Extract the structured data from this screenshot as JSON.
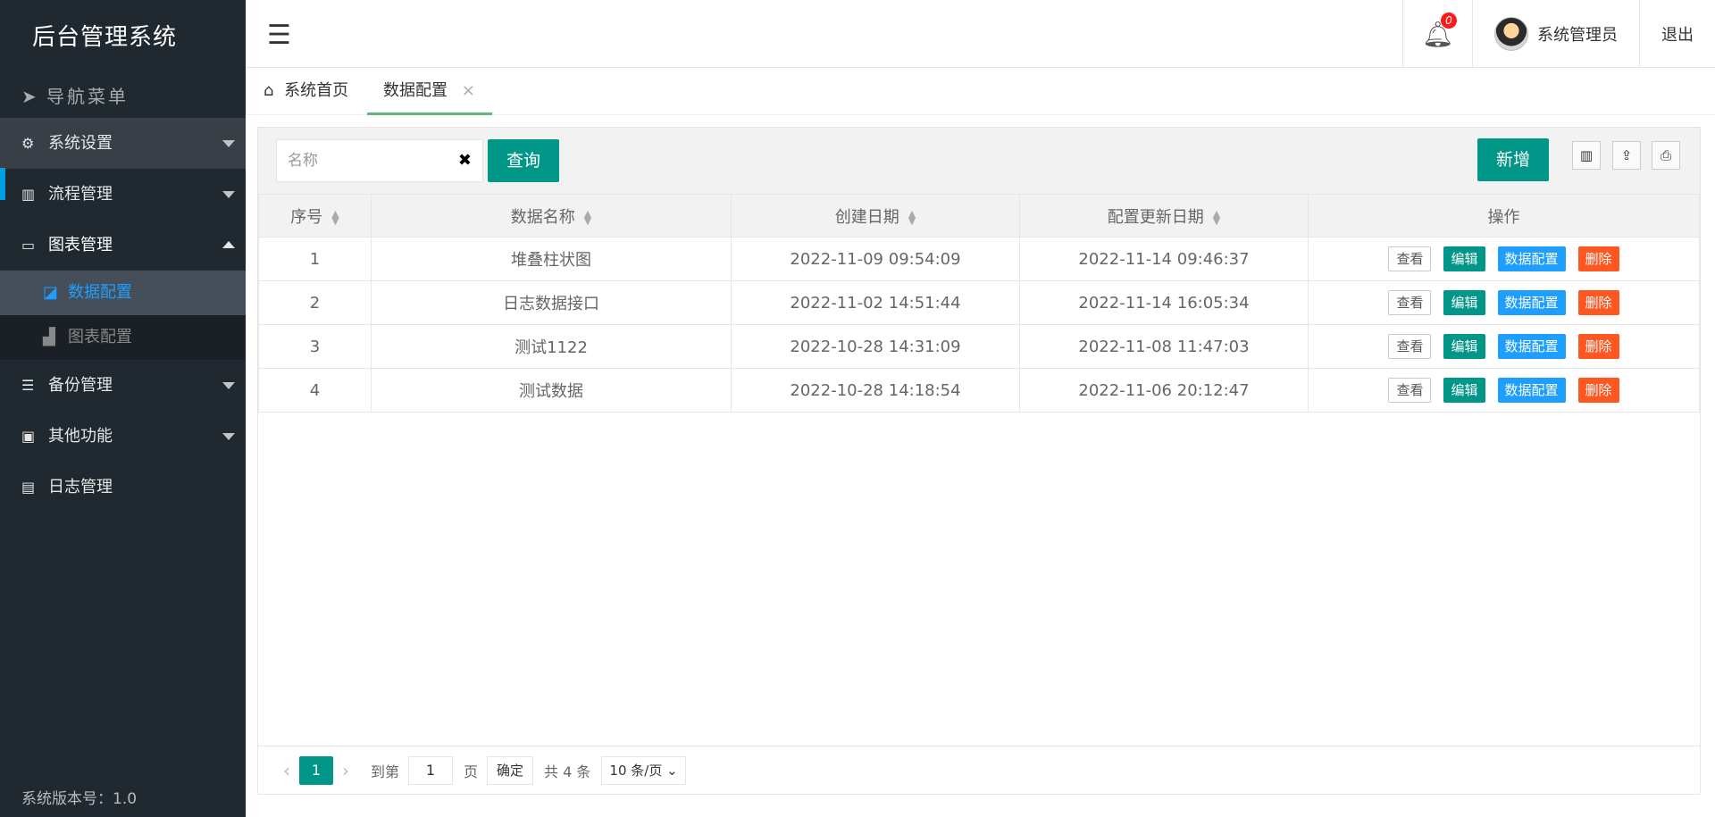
{
  "app": {
    "title": "后台管理系统",
    "version_label": "系统版本号：1.0"
  },
  "sidebar": {
    "header_label": "导航菜单",
    "items": [
      {
        "label": "系统设置",
        "icon": "gear-icon"
      },
      {
        "label": "流程管理",
        "icon": "barcode-icon"
      },
      {
        "label": "图表管理",
        "icon": "monitor-icon"
      },
      {
        "label": "备份管理",
        "icon": "database-icon"
      },
      {
        "label": "其他功能",
        "icon": "briefcase-icon"
      },
      {
        "label": "日志管理",
        "icon": "book-icon"
      }
    ],
    "sub_items": [
      {
        "label": "数据配置",
        "icon": "config-icon"
      },
      {
        "label": "图表配置",
        "icon": "bar-chart-icon"
      }
    ]
  },
  "topbar": {
    "menu_icon": "☰",
    "notification_count": "0",
    "user_name": "系统管理员",
    "logout_label": "退出"
  },
  "tabs": {
    "home_label": "系统首页",
    "current_label": "数据配置",
    "close_glyph": "×"
  },
  "search": {
    "placeholder": "名称",
    "clear_glyph": "✖",
    "query_label": "查询"
  },
  "toolbar": {
    "add_label": "新增",
    "icons": [
      "columns-icon",
      "export-icon",
      "print-icon"
    ]
  },
  "table": {
    "columns": [
      "序号",
      "数据名称",
      "创建日期",
      "配置更新日期",
      "操作"
    ],
    "action_labels": {
      "view": "查看",
      "edit": "编辑",
      "config": "数据配置",
      "delete": "删除"
    },
    "rows": [
      {
        "index": "1",
        "name": "堆叠柱状图",
        "created": "2022-11-09 09:54:09",
        "updated": "2022-11-14 09:46:37"
      },
      {
        "index": "2",
        "name": "日志数据接口",
        "created": "2022-11-02 14:51:44",
        "updated": "2022-11-14 16:05:34"
      },
      {
        "index": "3",
        "name": "测试1122",
        "created": "2022-10-28 14:31:09",
        "updated": "2022-11-08 11:47:03"
      },
      {
        "index": "4",
        "name": "测试数据",
        "created": "2022-10-28 14:18:54",
        "updated": "2022-11-06 20:12:47"
      }
    ]
  },
  "pager": {
    "current_page": "1",
    "goto_label": "到第",
    "goto_value": "1",
    "page_label": "页",
    "confirm_label": "确定",
    "total_label": "共 4 条",
    "page_size_label": "10 条/页"
  },
  "colors": {
    "primary": "#009688",
    "info": "#1e9fff",
    "danger": "#ff5722",
    "sidebar": "#20292f"
  }
}
